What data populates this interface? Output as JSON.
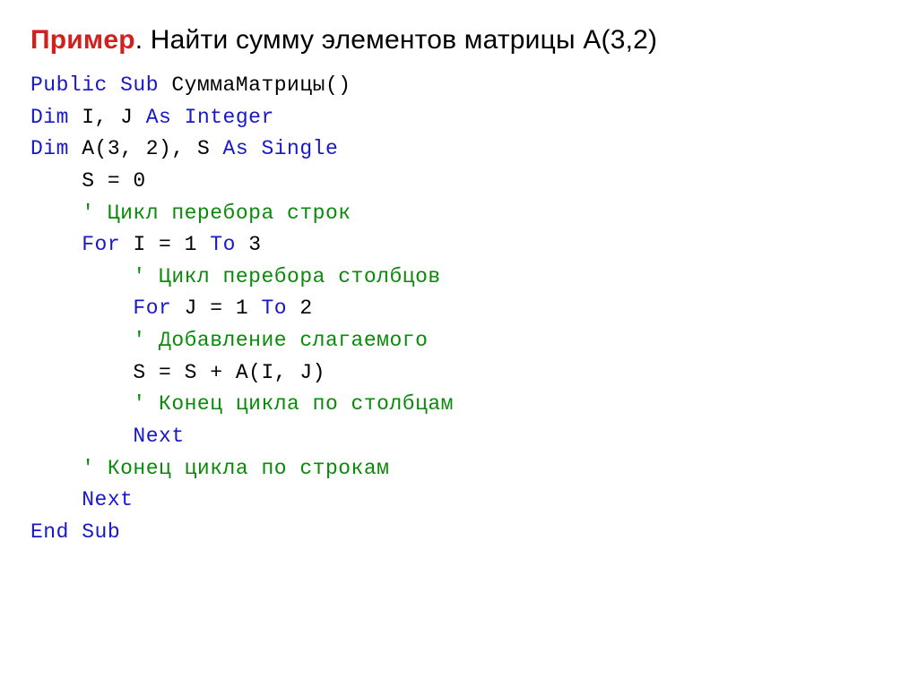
{
  "title": {
    "keyword": "Пример",
    "rest": ". Найти сумму элементов матрицы A(3,2)"
  },
  "code": {
    "l1": {
      "k1": "Public Sub ",
      "p1": "СуммаМатрицы()"
    },
    "l2": {
      "k1": "Dim ",
      "p1": "I, J ",
      "k2": "As Integer"
    },
    "l3": {
      "k1": "Dim ",
      "p1": "A(3, 2), S ",
      "k2": "As Single"
    },
    "l4": {
      "p1": "    S = 0"
    },
    "l5": {
      "c1": "    ' Цикл перебора строк"
    },
    "l6": {
      "p0": "    ",
      "k1": "For ",
      "p1": "I = 1 ",
      "k2": "To ",
      "p2": "3"
    },
    "l7": {
      "c1": "        ' Цикл перебора столбцов"
    },
    "l8": {
      "p0": "        ",
      "k1": "For ",
      "p1": "J = 1 ",
      "k2": "To ",
      "p2": "2"
    },
    "l9": {
      "c1": "        ' Добавление слагаемого"
    },
    "l10": {
      "p1": "        S = S + A(I, J)"
    },
    "l11": {
      "c1": "        ' Конец цикла по столбцам"
    },
    "l12": {
      "p0": "        ",
      "k1": "Next"
    },
    "l13": {
      "c1": "    ' Конец цикла по строкам"
    },
    "l14": {
      "p0": "    ",
      "k1": "Next"
    },
    "l15": {
      "k1": "End Sub"
    }
  }
}
